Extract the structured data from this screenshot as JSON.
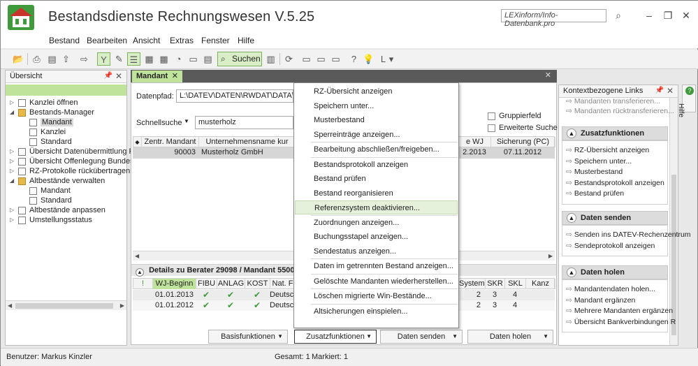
{
  "window": {
    "title": "Bestandsdienste Rechnungswesen V.5.25",
    "search_placeholder": "LEXinform/Info-Datenbank.pro"
  },
  "menu": [
    "Bestand",
    "Bearbeiten",
    "Ansicht",
    "Extras",
    "Fenster",
    "Hilfe"
  ],
  "toolbar": {
    "search_label": "Suchen"
  },
  "left_panel": {
    "title": "Übersicht",
    "tree": [
      {
        "label": "Kanzlei öffnen",
        "level": 0,
        "icon": "doc-icon"
      },
      {
        "label": "Bestands-Manager",
        "level": 0,
        "icon": "folder-icon",
        "expanded": true
      },
      {
        "label": "Mandant",
        "level": 1,
        "icon": "doc-icon",
        "selected": true
      },
      {
        "label": "Kanzlei",
        "level": 1,
        "icon": "doc-icon"
      },
      {
        "label": "Standard",
        "level": 1,
        "icon": "doc-icon"
      },
      {
        "label": "Übersicht Datenübermittlung Fi...",
        "level": 0,
        "icon": "doc-icon"
      },
      {
        "label": "Übersicht Offenlegung Bundes...",
        "level": 0,
        "icon": "doc-icon"
      },
      {
        "label": "RZ-Protokolle rückübertragen",
        "level": 0,
        "icon": "doc-icon"
      },
      {
        "label": "Altbestände verwalten",
        "level": 0,
        "icon": "folder-icon",
        "expanded": true
      },
      {
        "label": "Mandant",
        "level": 1,
        "icon": "doc-icon"
      },
      {
        "label": "Standard",
        "level": 1,
        "icon": "doc-icon"
      },
      {
        "label": "Altbestände anpassen",
        "level": 0,
        "icon": "doc-icon"
      },
      {
        "label": "Umstellungsstatus",
        "level": 0,
        "icon": "doc-icon"
      }
    ]
  },
  "document": {
    "tab_label": "Mandant",
    "datenpfad_label": "Datenpfad:",
    "datenpfad_value": "L:\\DATEV\\DATEN\\RWDAT\\DATA\\ST",
    "schnellsuche_label": "Schnellsuche",
    "schnellsuche_value": "musterholz",
    "gruppierfeld_label": "Gruppierfeld",
    "erweiterte_suche_label": "Erweiterte Suche",
    "grid_headers": [
      "Zentr. Mandant",
      "Unternehmensname kur",
      "e WJ",
      "Sicherung (PC)"
    ],
    "grid_row": [
      "90003",
      "Musterholz GmbH",
      "2.2013",
      "07.11.2012"
    ],
    "details_title": "Details zu Berater 29098 / Mandant 55003",
    "details_headers": [
      "WJ-Beginn",
      "FIBU",
      "ANLAG",
      "KOST",
      "Nat. F",
      "Systeme",
      "SKR",
      "SKL",
      "Kanz"
    ],
    "details_rows": [
      [
        "01.01.2013",
        "Deutsch",
        "2",
        "3",
        "4"
      ],
      [
        "01.01.2012",
        "Deutsch",
        "2",
        "3",
        "4"
      ]
    ],
    "buttons": [
      "Basisfunktionen",
      "Zusatzfunktionen",
      "Daten senden",
      "Daten holen"
    ]
  },
  "context_menu": {
    "items": [
      "RZ-Übersicht anzeigen",
      "Speichern unter...",
      "Musterbestand",
      "Sperreinträge anzeigen...",
      "Bearbeitung abschließen/freigeben...",
      "Bestandsprotokoll anzeigen",
      "Bestand prüfen",
      "Bestand reorganisieren",
      "Referenzsystem deaktivieren...",
      "Zuordnungen anzeigen...",
      "Buchungsstapel anzeigen...",
      "Sendestatus anzeigen...",
      "Daten im getrennten Bestand anzeigen...",
      "Gelöschte Mandanten wiederherstellen...",
      "Löschen migrierte Win-Bestände...",
      "Altsicherungen einspielen..."
    ],
    "highlighted": "Referenzsystem deaktivieren..."
  },
  "right_panel": {
    "title": "Kontextbezogene Links",
    "top_links": [
      "Mandanten transferieren...",
      "Mandanten rücktransferieren..."
    ],
    "sections": [
      {
        "title": "Zusatzfunktionen",
        "links": [
          "RZ-Übersicht anzeigen",
          "Speichern unter...",
          "Musterbestand",
          "Bestandsprotokoll anzeigen",
          "Bestand prüfen"
        ]
      },
      {
        "title": "Daten senden",
        "links": [
          "Senden ins DATEV-Rechenzentrum",
          "Sendeprotokoll anzeigen"
        ]
      },
      {
        "title": "Daten holen",
        "links": [
          "Mandantendaten holen...",
          "Mandant ergänzen",
          "Mehrere Mandanten ergänzen",
          "Übersicht Bankverbindungen R"
        ]
      }
    ],
    "hilfe_tab": "Hilfe"
  },
  "status": {
    "user": "Benutzer: Markus Kinzler",
    "gesamt": "Gesamt: 1",
    "markiert": "Markiert: 1"
  },
  "colors": {
    "accent_green": "#bfe39a",
    "check_green": "#3f9a3c"
  }
}
